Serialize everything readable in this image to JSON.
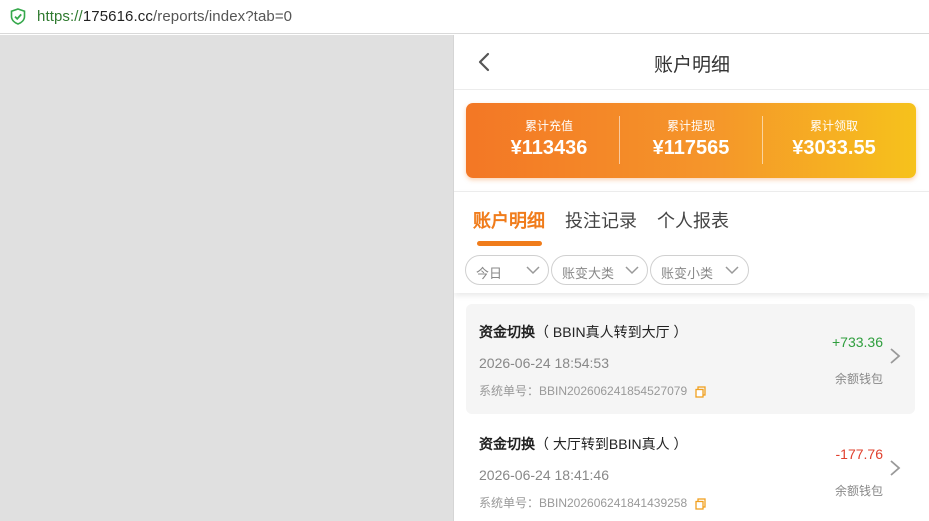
{
  "browser": {
    "url_scheme": "https://",
    "url_host": "175616.cc",
    "url_path": "/reports/index?tab=0"
  },
  "header": {
    "title": "账户明细"
  },
  "summary": {
    "stats": [
      {
        "label": "累计充值",
        "value": "¥113436"
      },
      {
        "label": "累计提现",
        "value": "¥117565"
      },
      {
        "label": "累计领取",
        "value": "¥3033.55"
      }
    ]
  },
  "tabs": [
    {
      "label": "账户明细",
      "active": true
    },
    {
      "label": "投注记录",
      "active": false
    },
    {
      "label": "个人报表",
      "active": false
    }
  ],
  "filters": [
    {
      "label": "今日"
    },
    {
      "label": "账变大类"
    },
    {
      "label": "账变小类"
    }
  ],
  "records": [
    {
      "type": "资金切换",
      "detail": "（ BBIN真人转到大厅 ）",
      "time": "2026-06-24 18:54:53",
      "order": "系统单号：BBIN202606241854527079",
      "amount": "+733.36",
      "wallet": "余额钱包"
    },
    {
      "type": "资金切换",
      "detail": "（ 大厅转到BBIN真人 ）",
      "time": "2026-06-24 18:41:46",
      "order": "系统单号：BBIN202606241841439258",
      "amount": "-177.76",
      "wallet": "余额钱包"
    }
  ],
  "colors": {
    "accent": "#f07c1b",
    "positive": "#2e9e3d",
    "negative": "#e0402e"
  }
}
